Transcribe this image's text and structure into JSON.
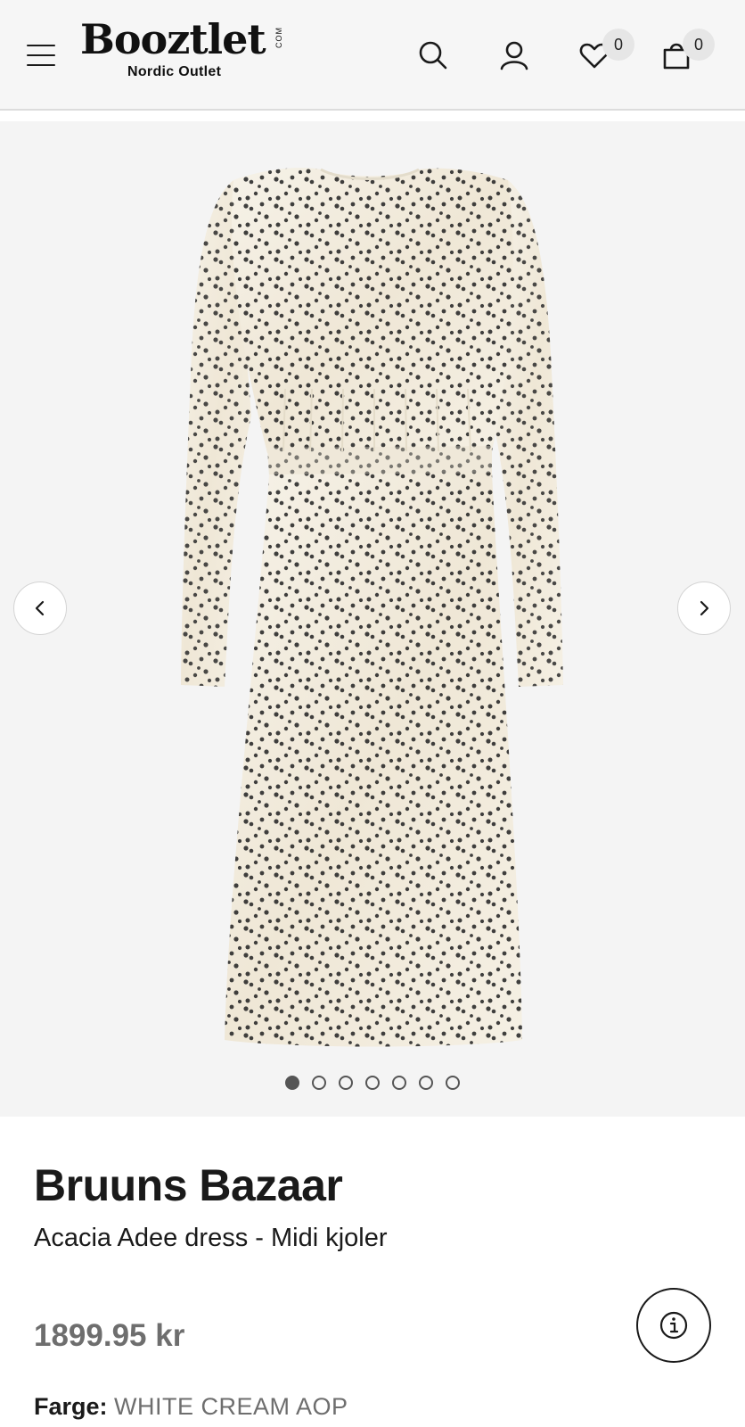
{
  "header": {
    "logo_text": "Booztlet",
    "logo_suffix": "COM",
    "logo_subtitle": "Nordic Outlet",
    "wishlist_count": "0",
    "cart_count": "0",
    "icons": [
      "menu-icon",
      "search-icon",
      "user-icon",
      "heart-icon",
      "bag-icon"
    ]
  },
  "gallery": {
    "image_count": 7,
    "active_index": 0,
    "icons": [
      "chevron-left-icon",
      "chevron-right-icon"
    ]
  },
  "product": {
    "brand": "Bruuns Bazaar",
    "name": "Acacia Adee dress - Midi kjoler",
    "price": "1899.95 kr",
    "color_label": "Farge:",
    "color_value": "WHITE CREAM AOP"
  },
  "colors": {
    "header_bg": "#f6f6f6",
    "gallery_bg": "#f4f4f4",
    "dress_fabric": "#f3eee3",
    "dot_print": "#2b2b2b",
    "price_text": "#6e6e6e"
  }
}
